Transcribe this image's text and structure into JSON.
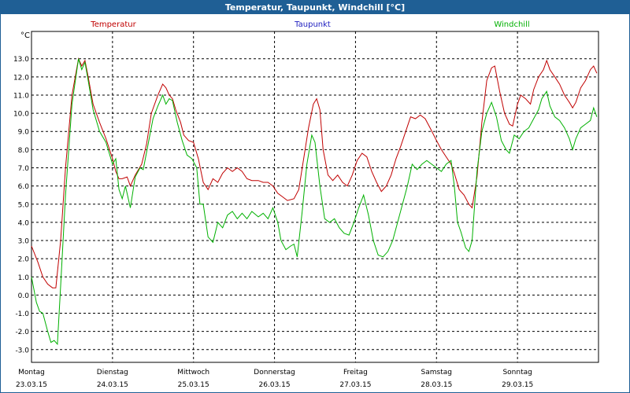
{
  "window": {
    "title": "Temperatur, Taupunkt, Windchill [°C]"
  },
  "colors": {
    "temperature": "#c00000",
    "dewpoint": "#2020c0",
    "windchill": "#00b000",
    "titlebar": "#1f5f95",
    "grid": "#000000"
  },
  "chart_data": {
    "type": "line",
    "title": "Temperatur, Taupunkt, Windchill [°C]",
    "ylabel": "°C",
    "ylim": [
      -3.7,
      14.5
    ],
    "grid": true,
    "legend_placement": "top",
    "y_ticks": [
      "13.0",
      "12.0",
      "11.0",
      "10.0",
      "9.0",
      "8.0",
      "7.0",
      "6.0",
      "5.0",
      "4.0",
      "3.0",
      "2.0",
      "1.0",
      "0.0",
      "-1.0",
      "-2.0",
      "-3.0"
    ],
    "day_labels": [
      {
        "day": "Montag",
        "date": "23.03.15"
      },
      {
        "day": "Dienstag",
        "date": "24.03.15"
      },
      {
        "day": "Mittwoch",
        "date": "25.03.15"
      },
      {
        "day": "Donnerstag",
        "date": "26.03.15"
      },
      {
        "day": "Freitag",
        "date": "27.03.15"
      },
      {
        "day": "Samstag",
        "date": "28.03.15"
      },
      {
        "day": "Sonntag",
        "date": "29.03.15"
      }
    ],
    "x_range_days": [
      0,
      7.0
    ],
    "series": [
      {
        "name": "Temperatur",
        "color": "#c00000",
        "points": [
          [
            0,
            2.7
          ],
          [
            0.08,
            1.8
          ],
          [
            0.14,
            1.0
          ],
          [
            0.2,
            0.6
          ],
          [
            0.26,
            0.4
          ],
          [
            0.3,
            0.4
          ],
          [
            0.36,
            3.0
          ],
          [
            0.42,
            7.0
          ],
          [
            0.5,
            11.0
          ],
          [
            0.58,
            13.0
          ],
          [
            0.62,
            12.6
          ],
          [
            0.66,
            12.9
          ],
          [
            0.7,
            12.0
          ],
          [
            0.76,
            10.5
          ],
          [
            0.84,
            9.5
          ],
          [
            0.92,
            8.6
          ],
          [
            1.0,
            7.5
          ],
          [
            1.04,
            6.8
          ],
          [
            1.08,
            6.4
          ],
          [
            1.12,
            6.4
          ],
          [
            1.18,
            6.5
          ],
          [
            1.22,
            6.0
          ],
          [
            1.28,
            6.6
          ],
          [
            1.36,
            7.2
          ],
          [
            1.42,
            8.3
          ],
          [
            1.48,
            10.0
          ],
          [
            1.56,
            11.0
          ],
          [
            1.62,
            11.6
          ],
          [
            1.66,
            11.4
          ],
          [
            1.7,
            11.0
          ],
          [
            1.74,
            10.8
          ],
          [
            1.78,
            10.2
          ],
          [
            1.84,
            9.5
          ],
          [
            1.88,
            8.8
          ],
          [
            1.94,
            8.5
          ],
          [
            2.0,
            8.4
          ],
          [
            2.06,
            7.5
          ],
          [
            2.12,
            6.2
          ],
          [
            2.18,
            5.8
          ],
          [
            2.24,
            6.4
          ],
          [
            2.3,
            6.2
          ],
          [
            2.36,
            6.7
          ],
          [
            2.42,
            7.0
          ],
          [
            2.48,
            6.8
          ],
          [
            2.54,
            7.0
          ],
          [
            2.6,
            6.8
          ],
          [
            2.66,
            6.4
          ],
          [
            2.72,
            6.3
          ],
          [
            2.8,
            6.3
          ],
          [
            2.86,
            6.2
          ],
          [
            2.92,
            6.2
          ],
          [
            2.98,
            6.0
          ],
          [
            3.04,
            5.6
          ],
          [
            3.1,
            5.4
          ],
          [
            3.16,
            5.2
          ],
          [
            3.24,
            5.3
          ],
          [
            3.3,
            5.8
          ],
          [
            3.36,
            7.5
          ],
          [
            3.42,
            9.2
          ],
          [
            3.48,
            10.5
          ],
          [
            3.52,
            10.8
          ],
          [
            3.56,
            10.2
          ],
          [
            3.6,
            8.0
          ],
          [
            3.66,
            6.6
          ],
          [
            3.72,
            6.3
          ],
          [
            3.78,
            6.6
          ],
          [
            3.84,
            6.2
          ],
          [
            3.9,
            6.0
          ],
          [
            3.96,
            6.6
          ],
          [
            4.02,
            7.4
          ],
          [
            4.08,
            7.8
          ],
          [
            4.14,
            7.6
          ],
          [
            4.2,
            6.8
          ],
          [
            4.26,
            6.2
          ],
          [
            4.32,
            5.7
          ],
          [
            4.38,
            6.0
          ],
          [
            4.44,
            6.6
          ],
          [
            4.5,
            7.5
          ],
          [
            4.56,
            8.2
          ],
          [
            4.62,
            9.0
          ],
          [
            4.68,
            9.8
          ],
          [
            4.74,
            9.7
          ],
          [
            4.8,
            9.9
          ],
          [
            4.86,
            9.7
          ],
          [
            4.92,
            9.2
          ],
          [
            5.0,
            8.5
          ],
          [
            5.06,
            8.0
          ],
          [
            5.12,
            7.6
          ],
          [
            5.18,
            7.2
          ],
          [
            5.22,
            6.7
          ],
          [
            5.28,
            5.8
          ],
          [
            5.34,
            5.5
          ],
          [
            5.4,
            5.0
          ],
          [
            5.44,
            4.8
          ],
          [
            5.5,
            6.5
          ],
          [
            5.56,
            9.5
          ],
          [
            5.62,
            11.8
          ],
          [
            5.68,
            12.5
          ],
          [
            5.72,
            12.6
          ],
          [
            5.78,
            11.2
          ],
          [
            5.84,
            10.0
          ],
          [
            5.9,
            9.4
          ],
          [
            5.94,
            9.3
          ],
          [
            6.0,
            10.5
          ],
          [
            6.04,
            11.0
          ],
          [
            6.1,
            10.8
          ],
          [
            6.16,
            10.5
          ],
          [
            6.2,
            11.3
          ],
          [
            6.26,
            12.0
          ],
          [
            6.32,
            12.4
          ],
          [
            6.36,
            12.9
          ],
          [
            6.4,
            12.4
          ],
          [
            6.46,
            12.0
          ],
          [
            6.52,
            11.6
          ],
          [
            6.58,
            11.0
          ],
          [
            6.64,
            10.6
          ],
          [
            6.68,
            10.3
          ],
          [
            6.72,
            10.6
          ],
          [
            6.78,
            11.4
          ],
          [
            6.84,
            11.8
          ],
          [
            6.9,
            12.4
          ],
          [
            6.94,
            12.6
          ],
          [
            6.98,
            12.2
          ],
          [
            7.02,
            13.0
          ],
          [
            7.08,
            12.6
          ],
          [
            7.12,
            11.4
          ],
          [
            7.18,
            10.0
          ],
          [
            7.22,
            9.8
          ],
          [
            7.28,
            10.2
          ]
        ]
      },
      {
        "name": "Taupunkt",
        "color": "#2020c0",
        "points": []
      },
      {
        "name": "Windchill",
        "color": "#00b000",
        "points": [
          [
            0,
            1.0
          ],
          [
            0.06,
            -0.4
          ],
          [
            0.1,
            -0.9
          ],
          [
            0.14,
            -1.0
          ],
          [
            0.2,
            -2.0
          ],
          [
            0.24,
            -2.6
          ],
          [
            0.28,
            -2.5
          ],
          [
            0.32,
            -2.7
          ],
          [
            0.36,
            0.5
          ],
          [
            0.42,
            5.5
          ],
          [
            0.5,
            10.5
          ],
          [
            0.58,
            13.0
          ],
          [
            0.62,
            12.4
          ],
          [
            0.66,
            12.8
          ],
          [
            0.7,
            11.8
          ],
          [
            0.76,
            10.2
          ],
          [
            0.84,
            9.0
          ],
          [
            0.92,
            8.4
          ],
          [
            1.0,
            7.2
          ],
          [
            1.04,
            7.5
          ],
          [
            1.08,
            5.8
          ],
          [
            1.12,
            5.3
          ],
          [
            1.16,
            6.0
          ],
          [
            1.22,
            4.8
          ],
          [
            1.28,
            6.5
          ],
          [
            1.34,
            7.0
          ],
          [
            1.38,
            6.9
          ],
          [
            1.44,
            8.3
          ],
          [
            1.5,
            9.7
          ],
          [
            1.56,
            10.4
          ],
          [
            1.62,
            11.0
          ],
          [
            1.66,
            10.5
          ],
          [
            1.7,
            10.8
          ],
          [
            1.74,
            10.7
          ],
          [
            1.8,
            9.5
          ],
          [
            1.86,
            8.5
          ],
          [
            1.92,
            7.7
          ],
          [
            1.98,
            7.5
          ],
          [
            2.04,
            7.0
          ],
          [
            2.08,
            5.0
          ],
          [
            2.12,
            5.0
          ],
          [
            2.18,
            3.2
          ],
          [
            2.24,
            2.9
          ],
          [
            2.3,
            4.0
          ],
          [
            2.36,
            3.7
          ],
          [
            2.42,
            4.4
          ],
          [
            2.48,
            4.6
          ],
          [
            2.54,
            4.2
          ],
          [
            2.6,
            4.5
          ],
          [
            2.66,
            4.2
          ],
          [
            2.72,
            4.6
          ],
          [
            2.8,
            4.3
          ],
          [
            2.86,
            4.5
          ],
          [
            2.92,
            4.2
          ],
          [
            2.98,
            4.8
          ],
          [
            3.04,
            4.0
          ],
          [
            3.08,
            3.0
          ],
          [
            3.14,
            2.5
          ],
          [
            3.2,
            2.7
          ],
          [
            3.24,
            2.8
          ],
          [
            3.28,
            2.1
          ],
          [
            3.34,
            4.5
          ],
          [
            3.4,
            7.2
          ],
          [
            3.46,
            8.8
          ],
          [
            3.5,
            8.4
          ],
          [
            3.56,
            6.0
          ],
          [
            3.62,
            4.2
          ],
          [
            3.68,
            4.0
          ],
          [
            3.74,
            4.2
          ],
          [
            3.8,
            3.7
          ],
          [
            3.86,
            3.4
          ],
          [
            3.92,
            3.3
          ],
          [
            3.98,
            4.0
          ],
          [
            4.04,
            4.8
          ],
          [
            4.1,
            5.5
          ],
          [
            4.16,
            4.4
          ],
          [
            4.22,
            3.0
          ],
          [
            4.28,
            2.2
          ],
          [
            4.34,
            2.1
          ],
          [
            4.4,
            2.4
          ],
          [
            4.46,
            3.0
          ],
          [
            4.52,
            4.0
          ],
          [
            4.58,
            5.0
          ],
          [
            4.64,
            6.0
          ],
          [
            4.7,
            7.2
          ],
          [
            4.76,
            6.9
          ],
          [
            4.82,
            7.2
          ],
          [
            4.88,
            7.4
          ],
          [
            4.94,
            7.2
          ],
          [
            5.0,
            7.0
          ],
          [
            5.06,
            6.8
          ],
          [
            5.12,
            7.2
          ],
          [
            5.18,
            7.4
          ],
          [
            5.22,
            6.0
          ],
          [
            5.26,
            4.0
          ],
          [
            5.3,
            3.5
          ],
          [
            5.36,
            2.6
          ],
          [
            5.4,
            2.4
          ],
          [
            5.44,
            3.0
          ],
          [
            5.5,
            6.8
          ],
          [
            5.56,
            9.0
          ],
          [
            5.62,
            10.0
          ],
          [
            5.68,
            10.6
          ],
          [
            5.74,
            9.8
          ],
          [
            5.8,
            8.5
          ],
          [
            5.86,
            8.0
          ],
          [
            5.9,
            7.8
          ],
          [
            5.96,
            8.8
          ],
          [
            6.02,
            8.6
          ],
          [
            6.08,
            9.0
          ],
          [
            6.14,
            9.2
          ],
          [
            6.2,
            9.7
          ],
          [
            6.26,
            10.2
          ],
          [
            6.3,
            10.8
          ],
          [
            6.36,
            11.2
          ],
          [
            6.4,
            10.4
          ],
          [
            6.46,
            9.8
          ],
          [
            6.52,
            9.6
          ],
          [
            6.58,
            9.2
          ],
          [
            6.64,
            8.6
          ],
          [
            6.68,
            8.0
          ],
          [
            6.72,
            8.6
          ],
          [
            6.78,
            9.2
          ],
          [
            6.84,
            9.4
          ],
          [
            6.9,
            9.6
          ],
          [
            6.94,
            10.3
          ],
          [
            6.98,
            9.8
          ],
          [
            7.02,
            10.0
          ],
          [
            7.08,
            8.8
          ],
          [
            7.12,
            7.5
          ],
          [
            7.16,
            6.1
          ],
          [
            7.22,
            6.6
          ],
          [
            7.28,
            6.9
          ]
        ]
      }
    ]
  }
}
